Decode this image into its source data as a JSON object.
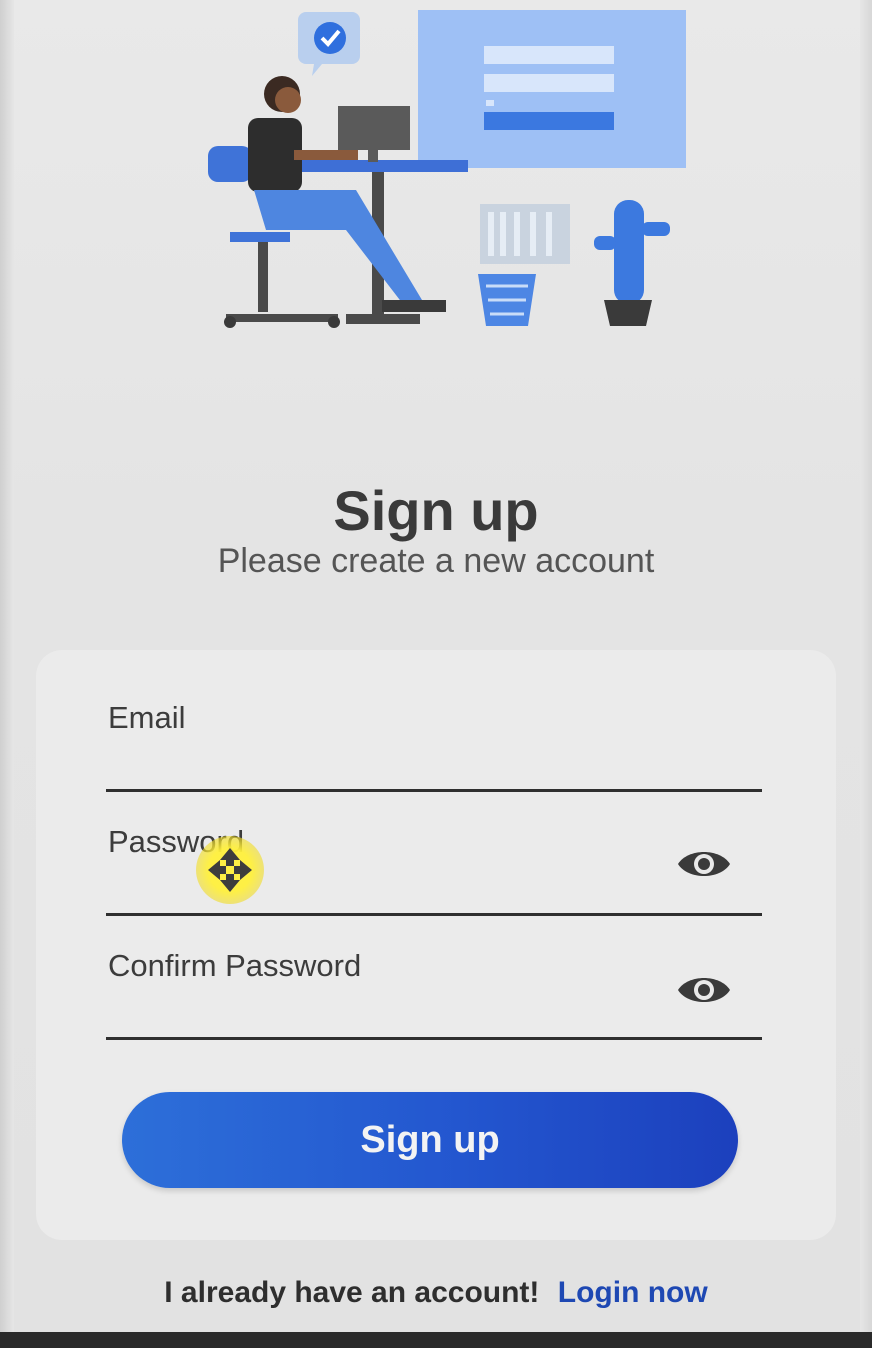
{
  "header": {
    "title": "Sign up",
    "subtitle": "Please create a new account"
  },
  "illustration": {
    "icon": "person-at-desk-signin-illustration",
    "accent_color": "#3f7fe6"
  },
  "form": {
    "email_label": "Email",
    "password_label": "Password",
    "confirm_password_label": "Confirm Password",
    "email_value": "",
    "password_value": "",
    "confirm_password_value": "",
    "submit_label": "Sign up"
  },
  "footer": {
    "prompt": "I already have an account!",
    "login_link": "Login now"
  },
  "colors": {
    "primary": "#2356cf",
    "link": "#1e48b3",
    "text": "#3a3a3a"
  }
}
